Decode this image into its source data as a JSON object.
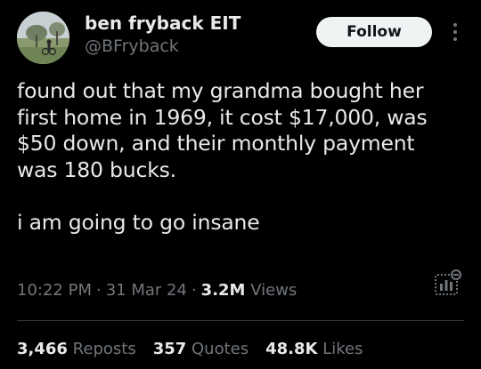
{
  "author": {
    "display_name": "ben fryback EIT",
    "handle": "@BFryback"
  },
  "follow_button_label": "Follow",
  "tweet": {
    "paragraph_1": "found out that my grandma bought her\nfirst home in 1969, it cost $17,000, was\n$50 down, and their monthly payment\nwas 180 bucks.",
    "paragraph_2": "i am going to go insane"
  },
  "meta": {
    "time": "10:22 PM",
    "separator": "·",
    "date": "31 Mar 24",
    "views_count": "3.2M",
    "views_label": "Views"
  },
  "stats": {
    "reposts_count": "3,466",
    "reposts_label": "Reposts",
    "quotes_count": "357",
    "quotes_label": "Quotes",
    "likes_count": "48.8K",
    "likes_label": "Likes"
  },
  "icons": {
    "more": "more-options-icon",
    "analytics": "post-analytics-icon"
  },
  "colors": {
    "background": "#000000",
    "text_primary": "#e7e9ea",
    "text_secondary": "#71767b",
    "follow_button_bg": "#eff3f4",
    "divider": "#2f3336"
  }
}
